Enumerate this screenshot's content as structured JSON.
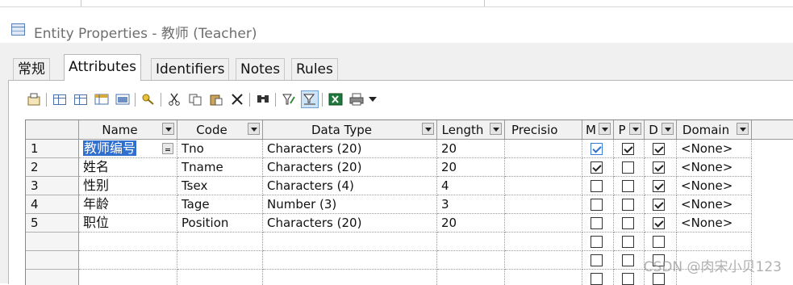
{
  "window": {
    "title": "Entity Properties - 教师 (Teacher)",
    "icon": "table-icon"
  },
  "tabs": [
    {
      "label": "常规",
      "active": false
    },
    {
      "label": "Attributes",
      "active": true
    },
    {
      "label": "Identifiers",
      "active": false
    },
    {
      "label": "Notes",
      "active": false
    },
    {
      "label": "Rules",
      "active": false
    }
  ],
  "toolbar": {
    "buttons": [
      "properties-icon",
      "insert-row-icon",
      "add-row-icon",
      "add-attributes-icon",
      "reuse-attributes-icon",
      "new-key-icon",
      "cut-icon",
      "copy-icon",
      "paste-icon",
      "delete-icon",
      "find-icon",
      "filter-icon",
      "customize-columns-icon",
      "excel-export-icon",
      "print-icon",
      "more-dropdown-icon"
    ]
  },
  "grid": {
    "columns": [
      "Name",
      "Code",
      "Data Type",
      "Length",
      "Precisio",
      "M",
      "P",
      "D",
      "Domain"
    ],
    "rows": [
      {
        "num": "1",
        "name": "教师编号",
        "code": "Tno",
        "data_type": "Characters (20)",
        "length": "20",
        "precision": "",
        "m": true,
        "p": true,
        "d": true,
        "domain": "<None>"
      },
      {
        "num": "2",
        "name": "姓名",
        "code": "Tname",
        "data_type": "Characters (20)",
        "length": "20",
        "precision": "",
        "m": true,
        "p": false,
        "d": true,
        "domain": "<None>"
      },
      {
        "num": "3",
        "name": "性别",
        "code": "Tsex",
        "data_type": "Characters (4)",
        "length": "4",
        "precision": "",
        "m": false,
        "p": false,
        "d": true,
        "domain": "<None>"
      },
      {
        "num": "4",
        "name": "年龄",
        "code": "Tage",
        "data_type": "Number (3)",
        "length": "3",
        "precision": "",
        "m": false,
        "p": false,
        "d": true,
        "domain": "<None>"
      },
      {
        "num": "5",
        "name": "职位",
        "code": "Position",
        "data_type": "Characters (20)",
        "length": "20",
        "precision": "",
        "m": false,
        "p": false,
        "d": true,
        "domain": "<None>"
      }
    ],
    "empty_rows": 3,
    "selected_row": 0
  },
  "watermark": "CSDN @肉宋小贝123",
  "colors": {
    "selection": "#2f6fd0",
    "panel_bg": "#f0f0f0",
    "title_text": "#6e6e6e"
  }
}
